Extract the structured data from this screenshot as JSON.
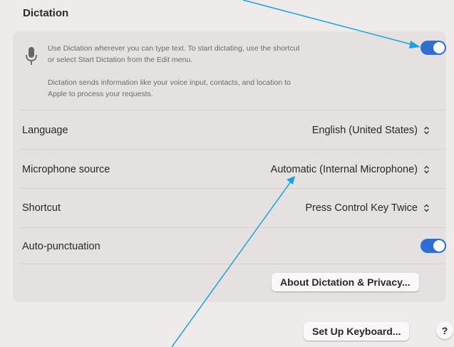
{
  "section": {
    "title": "Dictation"
  },
  "dictation": {
    "enabled": true,
    "description_line1": "Use Dictation wherever you can type text. To start dictating, use the shortcut",
    "description_line2": "or select Start Dictation from the Edit menu.",
    "privacy_line1": "Dictation sends information like your voice input, contacts, and location to",
    "privacy_line2": "Apple to process your requests.",
    "icon": "microphone-icon"
  },
  "rows": {
    "language": {
      "label": "Language",
      "value": "English (United States)"
    },
    "microphone_source": {
      "label": "Microphone source",
      "value": "Automatic (Internal Microphone)"
    },
    "shortcut": {
      "label": "Shortcut",
      "value": "Press Control Key Twice"
    },
    "auto_punctuation": {
      "label": "Auto-punctuation",
      "enabled": true
    }
  },
  "buttons": {
    "about_privacy": "About Dictation & Privacy...",
    "set_up_keyboard": "Set Up Keyboard...",
    "help": "?"
  },
  "colors": {
    "accent": "#2f6fd4",
    "annotation_arrow": "#1aa3dd",
    "background": "#efebeb",
    "panel": "#e6e1e1"
  }
}
